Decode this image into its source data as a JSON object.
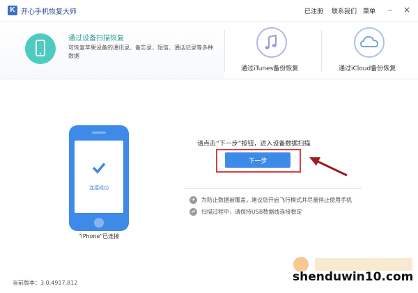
{
  "app": {
    "logo": "K",
    "title": "开心手机恢复大师"
  },
  "menu": {
    "registered": "已注册",
    "contact": "联系我们",
    "menu": "菜单",
    "minimize": "–",
    "close": "×"
  },
  "modes": {
    "device_scan": {
      "title": "通过设备扫描恢复",
      "description": "可恢复苹果设备的通讯录、备忘录、短信、通话记录等多种数据",
      "icon": "phone-icon"
    },
    "itunes": {
      "label": "通过iTunes备份恢复",
      "icon": "music-note-icon",
      "color": "#b6b6e6"
    },
    "icloud": {
      "label": "通过iCloud备份恢复",
      "icon": "cloud-icon",
      "color": "#a9c2e6"
    }
  },
  "device": {
    "status": "连接成功",
    "caption": "\"iPhone\"已连接",
    "color": "#3e8ae8"
  },
  "main": {
    "prompt": "请点击“下一步”按钮，进入设备数据扫描",
    "next_button": "下一步",
    "tips": [
      {
        "icon": "airplane-icon",
        "text": "为防止数据被覆盖，建议您开启飞行模式并尽量停止使用手机"
      },
      {
        "icon": "plug-icon",
        "text": "扫描过程中，请保持USB数据线连接稳定"
      }
    ]
  },
  "footer": {
    "version": "当前版本：3.0.4917.812"
  },
  "watermark": {
    "text": "shenduwin10.com"
  },
  "colors": {
    "accent": "#3e8ae8",
    "teal": "#4ecbc1",
    "highlight": "#d64040",
    "arrow": "#9b1c22"
  }
}
